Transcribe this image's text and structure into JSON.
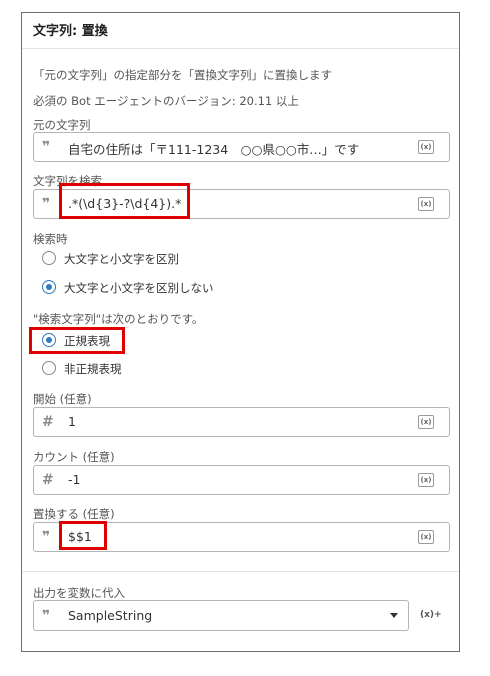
{
  "panel": {
    "title": "文字列: 置換",
    "description": "「元の文字列」の指定部分を「置換文字列」に置換します",
    "bot_version": "必須の Bot エージェントのバージョン: 20.11 以上"
  },
  "fields": {
    "source": {
      "label": "元の文字列",
      "prefix": "❞",
      "value": "自宅の住所は「〒111-1234　○○県○○市…」です"
    },
    "search": {
      "label": "文字列を検索",
      "prefix": "❞",
      "value": ".*(\\d{3}-?\\d{4}).*"
    },
    "start": {
      "label": "開始 (任意)",
      "prefix": "#",
      "value": "1"
    },
    "count": {
      "label": "カウント (任意)",
      "prefix": "#",
      "value": "-1"
    },
    "replace": {
      "label": "置換する (任意)",
      "prefix": "❞",
      "value": "$$1"
    }
  },
  "var_button": "(x)",
  "case_group": {
    "label": "検索時",
    "options": [
      "大文字と小文字を区別",
      "大文字と小文字を区別しない"
    ],
    "selected_index": 1
  },
  "type_group": {
    "label": "\"検索文字列\"は次のとおりです。",
    "options": [
      "正規表現",
      "非正規表現"
    ],
    "selected_index": 0
  },
  "output": {
    "label": "出力を変数に代入",
    "prefix": "❞",
    "value": "SampleString",
    "assign_icon": "(x)+"
  },
  "colors": {
    "accent": "#2f7bbf",
    "highlight": "#e00000"
  }
}
